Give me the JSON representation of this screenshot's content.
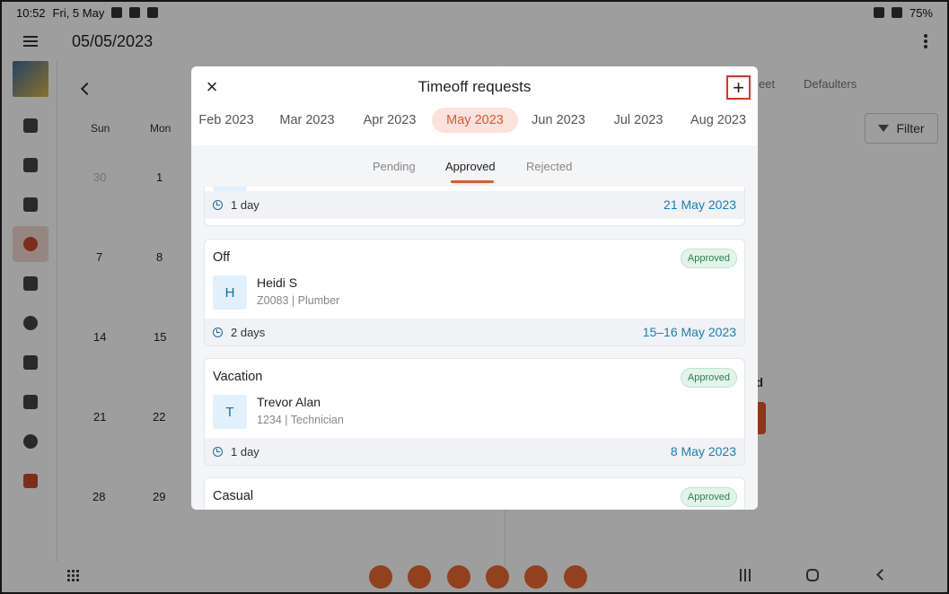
{
  "status_bar": {
    "time": "10:52",
    "date": "Fri, 5 May",
    "battery": "75%"
  },
  "app_bar": {
    "title": "05/05/2023"
  },
  "calendar": {
    "weekdays": [
      "Sun",
      "Mon"
    ],
    "rows": [
      [
        "30",
        "1"
      ],
      [
        "7",
        "8"
      ],
      [
        "14",
        "15"
      ],
      [
        "21",
        "22"
      ],
      [
        "28",
        "29"
      ]
    ]
  },
  "right_panel": {
    "tab_partial": "eet",
    "tab_defaulters": "Defaulters",
    "filter_label": "Filter",
    "partial_text": "nd"
  },
  "modal": {
    "title": "Timeoff requests",
    "months": [
      "Feb 2023",
      "Mar 2023",
      "Apr 2023",
      "May 2023",
      "Jun 2023",
      "Jul 2023",
      "Aug 2023"
    ],
    "selected_month": "May 2023",
    "status_tabs": [
      "Pending",
      "Approved",
      "Rejected"
    ],
    "active_status": "Approved",
    "requests": [
      {
        "duration": "1 day",
        "dates": "21 May 2023"
      },
      {
        "type": "Off",
        "status": "Approved",
        "initial": "H",
        "name": "Heidi S",
        "meta": "Z0083 | Plumber",
        "duration": "2 days",
        "dates": "15–16 May 2023"
      },
      {
        "type": "Vacation",
        "status": "Approved",
        "initial": "T",
        "name": "Trevor Alan",
        "meta": "1234 | Technician",
        "duration": "1 day",
        "dates": "8 May 2023"
      },
      {
        "type": "Casual",
        "status": "Approved"
      }
    ]
  },
  "colors": {
    "accent": "#e2572c",
    "link": "#1b7fb4",
    "approved_text": "#2e7d4f",
    "approved_bg": "#e2f4ea"
  }
}
